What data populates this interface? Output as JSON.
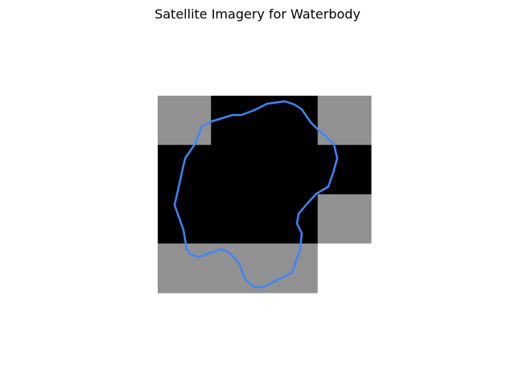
{
  "title": "Satellite Imagery for Waterbody",
  "grid": {
    "rows": 4,
    "cols": 4,
    "cells": [
      [
        "gray",
        "black",
        "black",
        "gray"
      ],
      [
        "black",
        "black",
        "black",
        "black"
      ],
      [
        "black",
        "black",
        "black",
        "gray"
      ],
      [
        "gray",
        "gray",
        "gray",
        "white"
      ]
    ]
  },
  "colors": {
    "gray": "#919191",
    "black": "#000000",
    "white": "#ffffff",
    "outline": "#3a86ff"
  }
}
